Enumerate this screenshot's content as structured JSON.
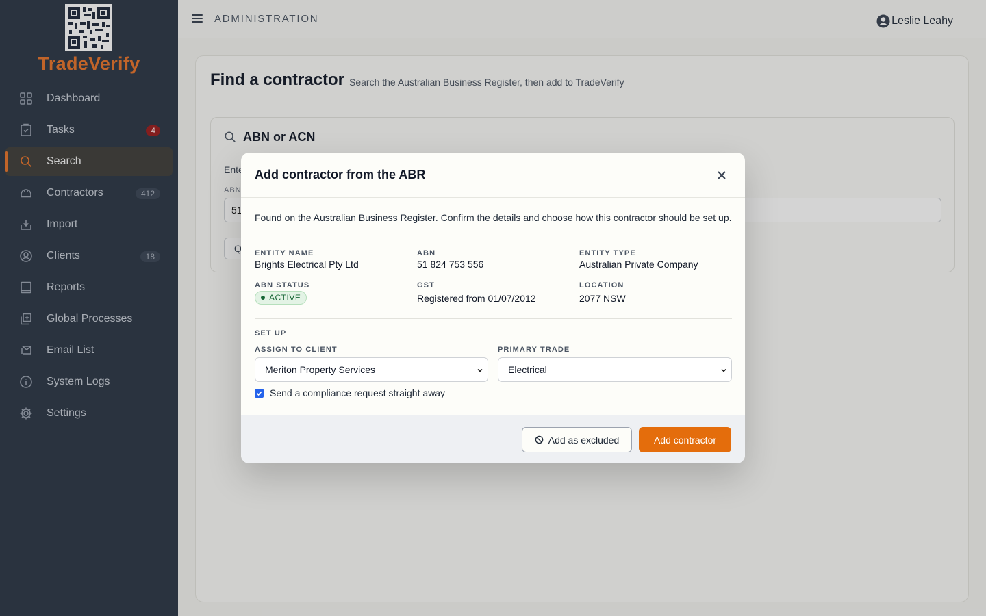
{
  "brand": {
    "name": "TradeVerify",
    "accent": "#e8742a"
  },
  "sidebar": {
    "items": [
      {
        "label": "Dashboard",
        "icon": "grid-icon",
        "badge": ""
      },
      {
        "label": "Tasks",
        "icon": "clipboard-check-icon",
        "badge": "4"
      },
      {
        "label": "Search",
        "icon": "search-icon",
        "badge": "",
        "active": true
      },
      {
        "label": "Contractors",
        "icon": "hard-hat-icon",
        "badge": "412"
      },
      {
        "label": "Import",
        "icon": "import-icon",
        "badge": ""
      },
      {
        "label": "Clients",
        "icon": "user-circle-icon",
        "badge": "18"
      },
      {
        "label": "Reports",
        "icon": "book-icon",
        "badge": ""
      },
      {
        "label": "Global Processes",
        "icon": "copy-plus-icon",
        "badge": ""
      },
      {
        "label": "Email List",
        "icon": "mail-send-icon",
        "badge": ""
      },
      {
        "label": "System Logs",
        "icon": "info-icon",
        "badge": ""
      },
      {
        "label": "Settings",
        "icon": "gear-icon",
        "badge": ""
      }
    ]
  },
  "topbar": {
    "title": "ADMINISTRATION",
    "user": "Leslie Leahy"
  },
  "page": {
    "title": "Find a contractor",
    "subtitle": "Search the Australian Business Register, then add to TradeVerify",
    "search_panel": {
      "title": "ABN or ACN",
      "hint": "Ente",
      "label": "ABN",
      "value": "51",
      "button": "Q"
    }
  },
  "modal": {
    "title": "Add contractor from the ABR",
    "intro": "Found on the Australian Business Register. Confirm the details and choose how this contractor should be set up.",
    "fields": {
      "entity_name": {
        "label": "ENTITY NAME",
        "value": "Brights Electrical Pty Ltd"
      },
      "abn": {
        "label": "ABN",
        "value": "51 824 753 556"
      },
      "entity_type": {
        "label": "ENTITY TYPE",
        "value": "Australian Private Company"
      },
      "abn_status": {
        "label": "ABN STATUS",
        "value": "ACTIVE"
      },
      "gst": {
        "label": "GST",
        "value": "Registered from 01/07/2012"
      },
      "location": {
        "label": "LOCATION",
        "value": "2077 NSW"
      }
    },
    "setup": {
      "section": "SET UP",
      "client_label": "ASSIGN TO CLIENT",
      "client_value": "Meriton Property Services",
      "trade_label": "PRIMARY TRADE",
      "trade_value": "Electrical",
      "checkbox_label": "Send a compliance request straight away",
      "checkbox_checked": true
    },
    "buttons": {
      "excluded": "Add as excluded",
      "add": "Add contractor"
    }
  }
}
